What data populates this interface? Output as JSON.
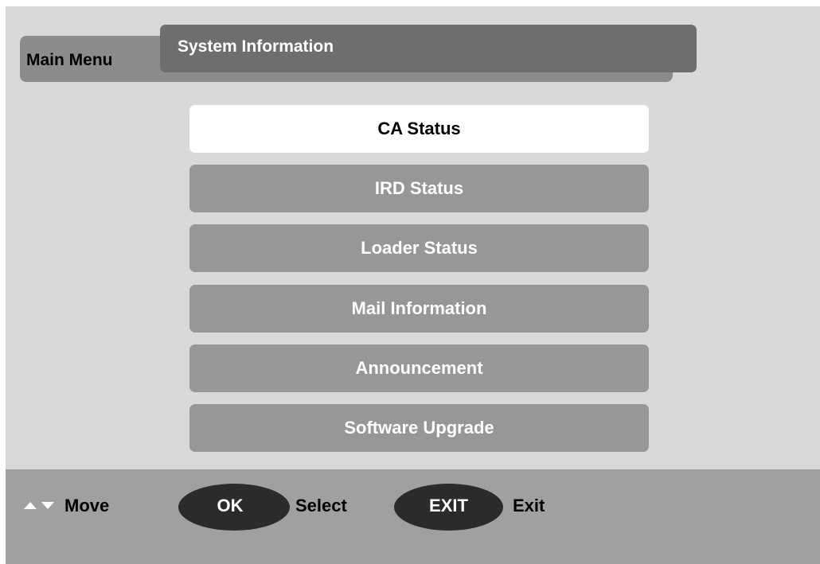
{
  "header": {
    "back_tab_label": "Main Menu",
    "front_tab_label": "System Information"
  },
  "menu": {
    "selected_index": 0,
    "items": [
      {
        "label": "CA Status"
      },
      {
        "label": "IRD Status"
      },
      {
        "label": "Loader Status"
      },
      {
        "label": "Mail Information"
      },
      {
        "label": "Announcement"
      },
      {
        "label": "Software Upgrade"
      }
    ]
  },
  "footer": {
    "move_label": "Move",
    "ok_key": "OK",
    "select_label": "Select",
    "exit_key": "EXIT",
    "exit_label": "Exit",
    "arrow_icons": [
      "up-arrow-icon",
      "down-arrow-icon"
    ]
  },
  "colors": {
    "screen_background": "#d9d9d9",
    "menu_item": "#979797",
    "menu_item_selected": "#ffffff",
    "footer_background": "#a0a0a0",
    "key_pill": "#2b2b2b"
  }
}
